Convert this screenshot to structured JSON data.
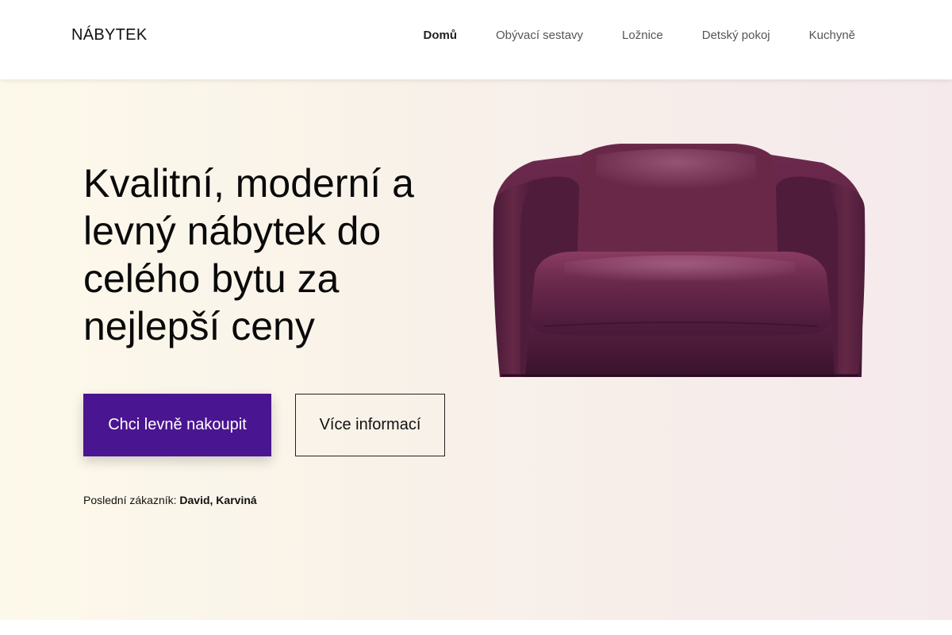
{
  "header": {
    "logo": "NÁBYTEK",
    "nav": [
      {
        "label": "Domů",
        "active": true
      },
      {
        "label": "Obývací sestavy",
        "active": false
      },
      {
        "label": "Ložnice",
        "active": false
      },
      {
        "label": "Detský pokoj",
        "active": false
      },
      {
        "label": "Kuchyně",
        "active": false
      }
    ]
  },
  "hero": {
    "headline": "Kvalitní, moderní a levný nábytek do celého bytu za nejlepší ceny",
    "primary_button": "Chci levně nakoupit",
    "secondary_button": "Více informací",
    "customer_label": "Poslední zákazník:",
    "customer_name": "David, Karviná",
    "image_subject": "purple-leather-armchair"
  },
  "colors": {
    "accent": "#4a1590",
    "sofa": "#5a2340"
  }
}
